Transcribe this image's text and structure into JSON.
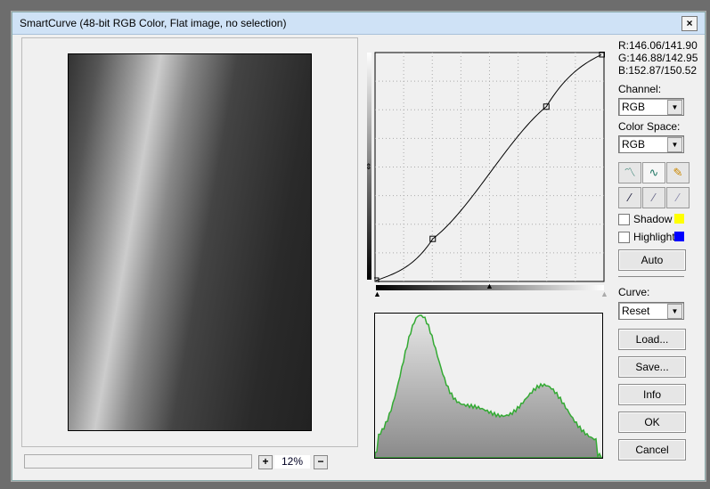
{
  "window": {
    "title": "SmartCurve (48-bit RGB Color, Flat image, no selection)",
    "close_label": "×"
  },
  "readout": {
    "r": "R:146.06/141.90",
    "g": "G:146.88/142.95",
    "b": "B:152.87/150.52"
  },
  "channel": {
    "label": "Channel:",
    "value": "RGB"
  },
  "color_space": {
    "label": "Color Space:",
    "value": "RGB"
  },
  "tools": [
    "line-curve-icon",
    "smooth-curve-icon",
    "pencil-icon",
    "black-eyedropper-icon",
    "gray-eyedropper-icon",
    "white-eyedropper-icon"
  ],
  "shadow": {
    "label": "Shadow",
    "checked": false,
    "color": "#ffff00"
  },
  "highlight": {
    "label": "Highlight",
    "checked": false,
    "color": "#0000ff"
  },
  "buttons": {
    "auto": "Auto",
    "load": "Load...",
    "save": "Save...",
    "info": "Info",
    "ok": "OK",
    "cancel": "Cancel"
  },
  "curve": {
    "label": "Curve:",
    "value": "Reset",
    "points": [
      [
        0,
        0
      ],
      [
        64,
        47
      ],
      [
        192,
        196
      ],
      [
        255,
        255
      ]
    ]
  },
  "zoom": {
    "plus": "+",
    "value": "12%",
    "minus": "−"
  }
}
